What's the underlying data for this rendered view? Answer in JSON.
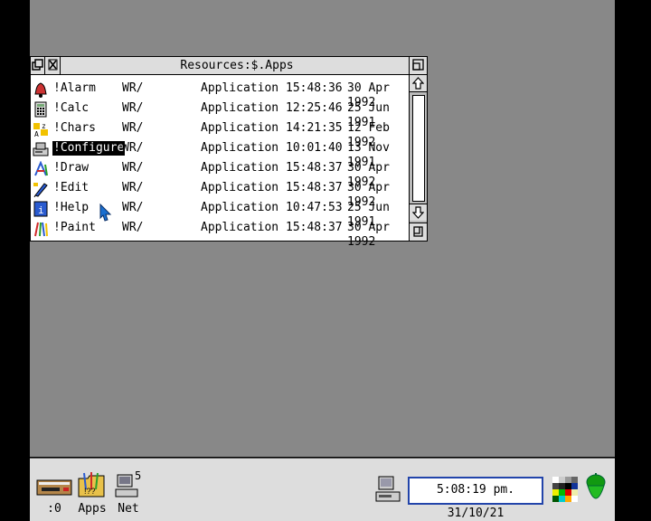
{
  "window": {
    "title": "Resources:$.Apps",
    "files": [
      {
        "name": "!Alarm",
        "access": "WR/",
        "type": "Application",
        "time": "15:48:36",
        "date": "30 Apr 1992",
        "icon": "alarm-bell-icon",
        "selected": false
      },
      {
        "name": "!Calc",
        "access": "WR/",
        "type": "Application",
        "time": "12:25:46",
        "date": "25 Jun 1991",
        "icon": "calculator-icon",
        "selected": false
      },
      {
        "name": "!Chars",
        "access": "WR/",
        "type": "Application",
        "time": "14:21:35",
        "date": "12 Feb 1992",
        "icon": "chars-icon",
        "selected": false
      },
      {
        "name": "!Configure",
        "access": "WR/",
        "type": "Application",
        "time": "10:01:40",
        "date": "13 Nov 1991",
        "icon": "configure-icon",
        "selected": true
      },
      {
        "name": "!Draw",
        "access": "WR/",
        "type": "Application",
        "time": "15:48:37",
        "date": "30 Apr 1992",
        "icon": "draw-icon",
        "selected": false
      },
      {
        "name": "!Edit",
        "access": "WR/",
        "type": "Application",
        "time": "15:48:37",
        "date": "30 Apr 1992",
        "icon": "edit-pen-icon",
        "selected": false
      },
      {
        "name": "!Help",
        "access": "WR/",
        "type": "Application",
        "time": "10:47:53",
        "date": "25 Jun 1991",
        "icon": "help-icon",
        "selected": false
      },
      {
        "name": "!Paint",
        "access": "WR/",
        "type": "Application",
        "time": "15:48:37",
        "date": "30 Apr 1992",
        "icon": "paint-brushes-icon",
        "selected": false
      }
    ]
  },
  "iconbar": {
    "drive_label": ":0",
    "apps_label": "Apps",
    "net_label": "Net",
    "net_badge": "5",
    "clock": "5:08:19 pm. 31/10/21"
  },
  "colors": {
    "desktop": "#888888",
    "window_background": "#ffffff",
    "titlebar": "#dddddd",
    "iconbar": "#dddddd",
    "clock_border": "#2244aa",
    "pointer": "#1a6fd0"
  }
}
